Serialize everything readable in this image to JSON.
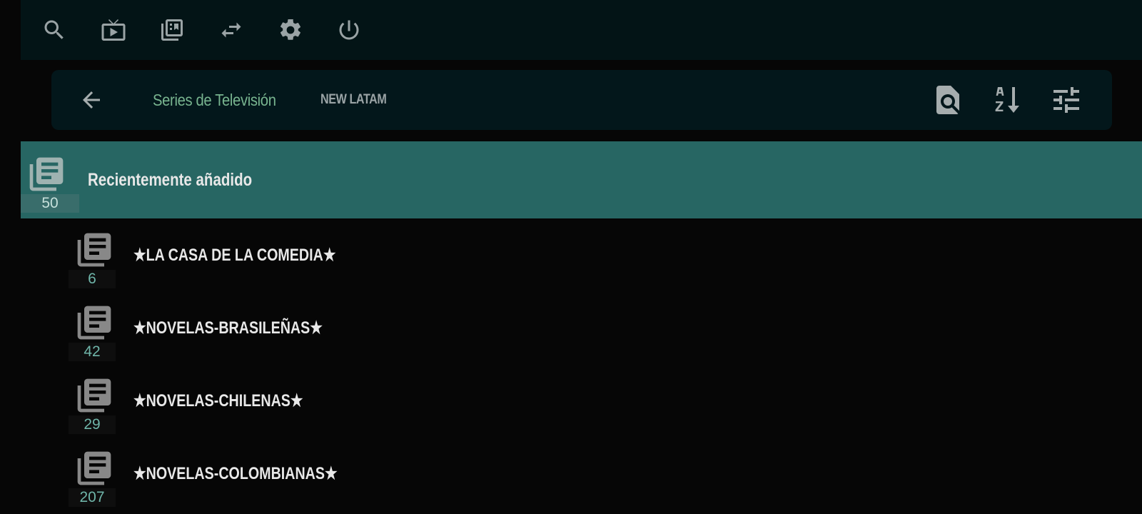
{
  "topbar": {
    "icons": [
      "search-icon",
      "tv-icon",
      "media-library-icon",
      "swap-icon",
      "settings-icon",
      "power-icon"
    ]
  },
  "navbar": {
    "tabs": [
      {
        "label": "Series de Televisión",
        "active": true
      },
      {
        "label": "NEW LATAM",
        "active": false
      }
    ],
    "tools": [
      "search-list-icon",
      "sort-az-icon",
      "tune-icon"
    ]
  },
  "colors": {
    "background": "#060606",
    "topbar": "#031416",
    "navbar": "#03171b",
    "selected_row": "#276663",
    "active_tab": "#78b48f",
    "count_text": "#6fb5a9"
  },
  "categories": [
    {
      "label": "Recientemente añadido",
      "count": "50",
      "selected": true
    },
    {
      "label": "★LA CASA DE LA COMEDIA★",
      "count": "6",
      "selected": false
    },
    {
      "label": "★NOVELAS-BRASILEÑAS★",
      "count": "42",
      "selected": false
    },
    {
      "label": "★NOVELAS-CHILENAS★",
      "count": "29",
      "selected": false
    },
    {
      "label": "★NOVELAS-COLOMBIANAS★",
      "count": "207",
      "selected": false
    }
  ]
}
